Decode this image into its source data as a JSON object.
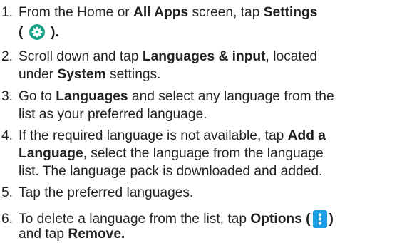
{
  "steps": [
    {
      "number": "1.",
      "l1_a": "From the Home or ",
      "l1_b": "All Apps",
      "l1_c": " screen, tap ",
      "l1_d": "Settings",
      "l2_a": "(",
      "l2_b": ")."
    },
    {
      "number": "2.",
      "l1_a": "Scroll down and tap ",
      "l1_b": "Languages & input",
      "l1_c": ", located",
      "l2_a": "under ",
      "l2_b": "System",
      "l2_c": " settings."
    },
    {
      "number": "3.",
      "l1_a": "Go to ",
      "l1_b": "Languages",
      "l1_c": " and select any language from the",
      "l2_a": "list as your preferred language."
    },
    {
      "number": "4.",
      "l1_a": "If the required language is not available, tap ",
      "l1_b": "Add a",
      "l2_a": "Language",
      "l2_b": ", select the language from the language",
      "l3_a": "list. The language pack is downloaded and added."
    },
    {
      "number": "5.",
      "l1_a": "Tap the preferred languages."
    },
    {
      "number": "6.",
      "l1_a": "To delete a language from the list, tap ",
      "l1_b": "Options (",
      "l1_c": ")",
      "l2_a": "and tap ",
      "l2_b": "Remove."
    }
  ],
  "icons": {
    "settings": "settings-gear-icon",
    "options": "more-vertical-icon",
    "settings_color": "#19a389",
    "options_color": "#1a9ee6"
  }
}
